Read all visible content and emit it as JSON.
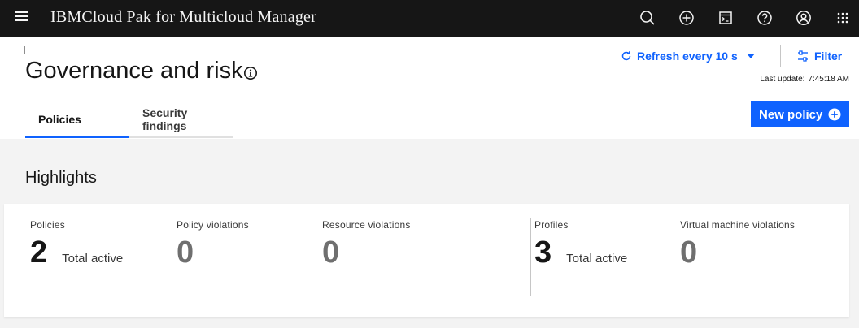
{
  "app": {
    "product_name": "IBMCloud Pak for Multicloud Manager"
  },
  "header_icons": [
    "search-icon",
    "add-icon",
    "terminal-icon",
    "help-icon",
    "user-icon",
    "app-switcher-icon"
  ],
  "page": {
    "title": "Governance and risk",
    "refresh_label": "Refresh every 10 s",
    "filter_label": "Filter",
    "last_update_label": "Last update:",
    "last_update_value": "7:45:18 AM",
    "new_policy_label": "New policy"
  },
  "tabs": [
    {
      "label": "Policies",
      "active": true
    },
    {
      "label": "Security findings",
      "active": false
    }
  ],
  "highlights": {
    "title": "Highlights",
    "stats": [
      {
        "label": "Policies",
        "value": "2",
        "sub": "Total active"
      },
      {
        "label": "Policy violations",
        "value": "0",
        "sub": ""
      },
      {
        "label": "Resource violations",
        "value": "0",
        "sub": ""
      },
      {
        "label": "Profiles",
        "value": "3",
        "sub": "Total active"
      },
      {
        "label": "Virtual machine violations",
        "value": "0",
        "sub": ""
      }
    ]
  },
  "colors": {
    "header_bg": "#161616",
    "accent": "#0f62fe",
    "page_bg": "#f3f3f3"
  }
}
